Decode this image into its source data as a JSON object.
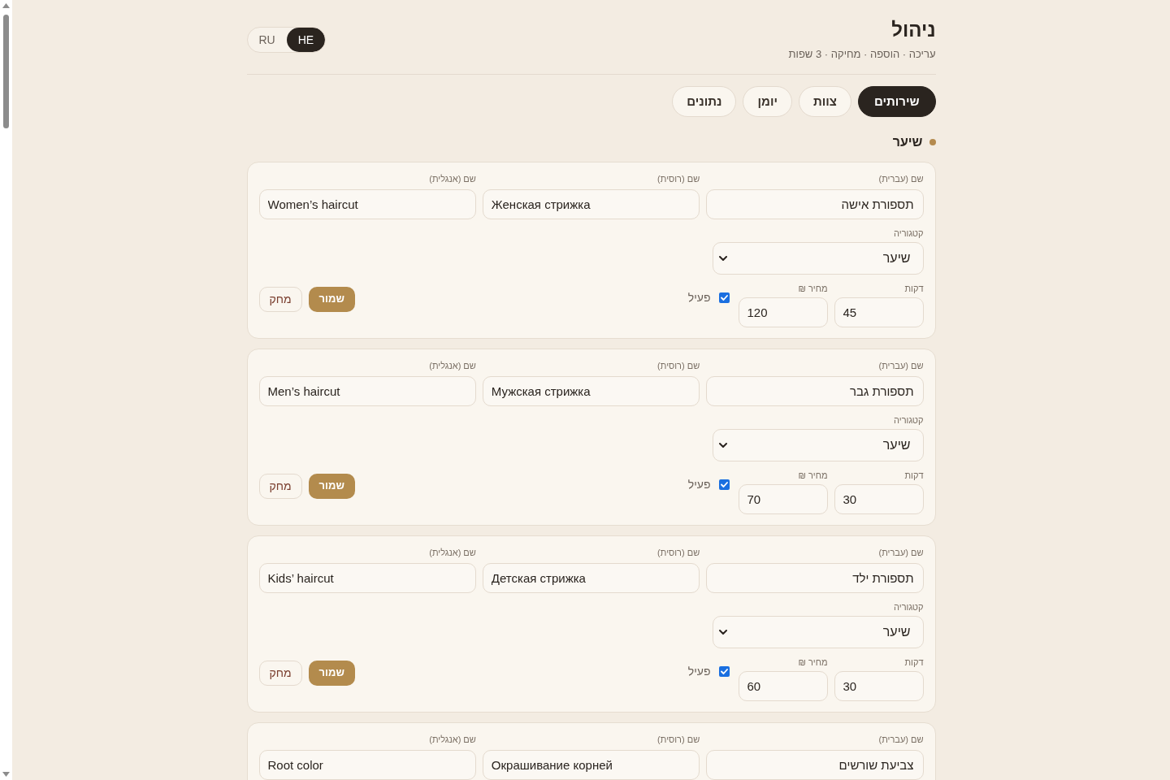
{
  "header": {
    "title": "ניהול",
    "subtitle": "עריכה · הוספה · מחיקה · 3 שפות"
  },
  "languages": [
    {
      "label": "HE",
      "selected": true
    },
    {
      "label": "RU",
      "selected": false
    }
  ],
  "tabs": [
    {
      "label": "שירותים",
      "selected": true
    },
    {
      "label": "צוות",
      "selected": false
    },
    {
      "label": "יומן",
      "selected": false
    },
    {
      "label": "נתונים",
      "selected": false
    }
  ],
  "section": {
    "title": "שיער"
  },
  "services": [
    {
      "name_he": {
        "label": "שם (עברית)",
        "value": "תספורת אישה"
      },
      "name_ru": {
        "label": "שם (רוסית)",
        "value": "Женская стрижка"
      },
      "name_en": {
        "label": "שם (אנגלית)",
        "value": "Women’s haircut"
      },
      "category": {
        "label": "קטגוריה",
        "value": "שיער"
      },
      "minutes": {
        "label": "דקות",
        "value": "45"
      },
      "price": {
        "label": "מחיר ₪",
        "value": "120"
      },
      "active": {
        "label": "פעיל",
        "checked": true
      },
      "save_button": "שמור",
      "delete_button": "מחק"
    },
    {
      "name_he": {
        "label": "שם (עברית)",
        "value": "תספורת גבר"
      },
      "name_ru": {
        "label": "שם (רוסית)",
        "value": "Мужская стрижка"
      },
      "name_en": {
        "label": "שם (אנגלית)",
        "value": "Men’s haircut"
      },
      "category": {
        "label": "קטגוריה",
        "value": "שיער"
      },
      "minutes": {
        "label": "דקות",
        "value": "30"
      },
      "price": {
        "label": "מחיר ₪",
        "value": "70"
      },
      "active": {
        "label": "פעיל",
        "checked": true
      },
      "save_button": "שמור",
      "delete_button": "מחק"
    },
    {
      "name_he": {
        "label": "שם (עברית)",
        "value": "תספורת ילד"
      },
      "name_ru": {
        "label": "שם (רוסית)",
        "value": "Детская стрижка"
      },
      "name_en": {
        "label": "שם (אנגלית)",
        "value": "Kids’ haircut"
      },
      "category": {
        "label": "קטגוריה",
        "value": "שיער"
      },
      "minutes": {
        "label": "דקות",
        "value": "30"
      },
      "price": {
        "label": "מחיר ₪",
        "value": "60"
      },
      "active": {
        "label": "פעיל",
        "checked": true
      },
      "save_button": "שמור",
      "delete_button": "מחק"
    },
    {
      "name_he": {
        "label": "שם (עברית)",
        "value": "צביעת שורשים"
      },
      "name_ru": {
        "label": "שם (רוסית)",
        "value": "Окрашивание корней"
      },
      "name_en": {
        "label": "שם (אנגלית)",
        "value": "Root color"
      }
    }
  ]
}
